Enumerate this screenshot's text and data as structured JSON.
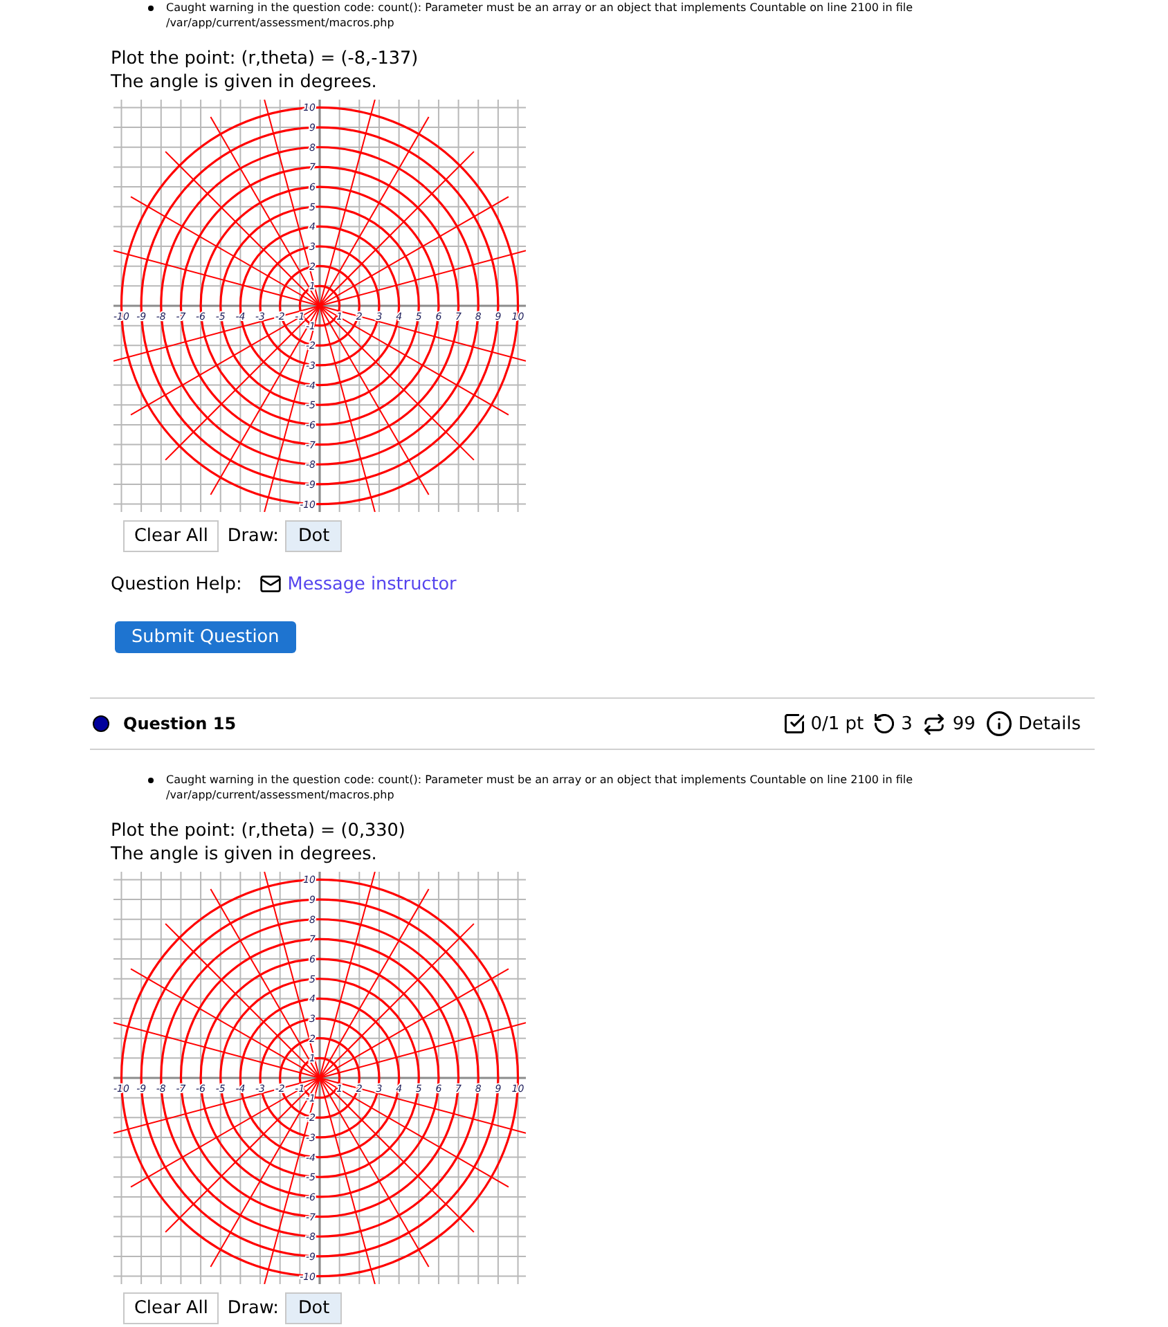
{
  "questions": [
    {
      "warnings": [
        "Caught warning in the question code: count(): Parameter must be an array or an object that implements Countable on line 2100 in file /var/app/current/assessment/macros.php"
      ],
      "prompt": [
        "Plot the point: (r,theta) = (-8,-137)",
        "The angle is given in degrees."
      ],
      "graph": {
        "x_axis_labels": [
          "-10",
          "-9",
          "-8",
          "-7",
          "-6",
          "-5",
          "-4",
          "-3",
          "-2",
          "-1",
          "1",
          "2",
          "3",
          "4",
          "5",
          "6",
          "7",
          "8",
          "9",
          "10"
        ],
        "y_axis_labels": [
          "10",
          "9",
          "8",
          "7",
          "6",
          "5",
          "4",
          "3",
          "2",
          "1",
          "-1",
          "-2",
          "-3",
          "-4",
          "-5",
          "-6",
          "-7",
          "-8",
          "-9",
          "-10"
        ]
      },
      "toolbar": {
        "clear_button": "Clear All",
        "draw_label": "Draw:",
        "tools": [
          {
            "label": "Dot",
            "selected": true
          }
        ]
      },
      "help": {
        "label": "Question Help:",
        "link": "Message instructor"
      },
      "submit_button": "Submit Question"
    },
    {
      "header": {
        "title": "Question 15",
        "stats": [
          {
            "kind": "score",
            "text": "0/1 pt"
          },
          {
            "kind": "tries",
            "text": "3"
          },
          {
            "kind": "versions",
            "text": "99"
          },
          {
            "kind": "details",
            "text": "Details"
          }
        ]
      },
      "warnings": [
        "Caught warning in the question code: count(): Parameter must be an array or an object that implements Countable on line 2100 in file /var/app/current/assessment/macros.php"
      ],
      "prompt": [
        "Plot the point: (r,theta) = (0,330)",
        "The angle is given in degrees."
      ],
      "graph": {
        "x_axis_labels": [
          "-10",
          "-9",
          "-8",
          "-7",
          "-6",
          "-5",
          "-4",
          "-3",
          "-2",
          "-1",
          "1",
          "2",
          "3",
          "4",
          "5",
          "6",
          "7",
          "8",
          "9",
          "10"
        ],
        "y_axis_labels": [
          "10",
          "9",
          "8",
          "7",
          "6",
          "5",
          "4",
          "3",
          "2",
          "1",
          "-1",
          "-2",
          "-3",
          "-4",
          "-5",
          "-6",
          "-7",
          "-8",
          "-9",
          "-10"
        ]
      },
      "toolbar": {
        "clear_button": "Clear All",
        "draw_label": "Draw:",
        "tools": [
          {
            "label": "Dot",
            "selected": true
          }
        ]
      }
    }
  ]
}
